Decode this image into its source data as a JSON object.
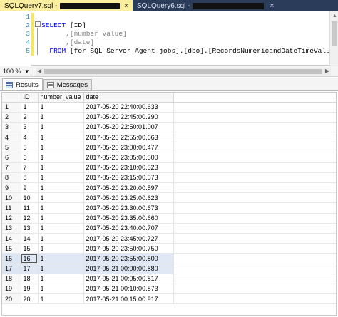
{
  "tabs": [
    {
      "label": "SQLQuery7.sql -",
      "close": "×",
      "active": true
    },
    {
      "label": "SQLQuery6.sql -",
      "close": "×",
      "active": false
    }
  ],
  "editor": {
    "line_numbers": [
      "1",
      "2",
      "3",
      "4",
      "5"
    ],
    "collapse_glyph": "−",
    "lines": [
      {
        "kw": "",
        "rest": ""
      },
      {
        "kw": "SELECT",
        "rest": " [ID]"
      },
      {
        "kw": "",
        "rest": "      ,[number_value]"
      },
      {
        "kw": "",
        "rest": "      ,[date]"
      },
      {
        "kw": "  FROM",
        "rest": " [for_SQL_Server_Agent_jobs].[dbo].[RecordsNumericandDateTimeValues]"
      }
    ]
  },
  "zoom": {
    "value": "100 %",
    "arrow": "▾"
  },
  "result_tabs": [
    {
      "label": "Results",
      "active": true
    },
    {
      "label": "Messages",
      "active": false
    }
  ],
  "grid": {
    "columns": [
      "ID",
      "number_value",
      "date"
    ],
    "rows": [
      {
        "rn": "1",
        "id": "1",
        "nv": "1",
        "date": "2017-05-20 22:40:00.633"
      },
      {
        "rn": "2",
        "id": "2",
        "nv": "1",
        "date": "2017-05-20 22:45:00.290"
      },
      {
        "rn": "3",
        "id": "3",
        "nv": "1",
        "date": "2017-05-20 22:50:01.007"
      },
      {
        "rn": "4",
        "id": "4",
        "nv": "1",
        "date": "2017-05-20 22:55:00.663"
      },
      {
        "rn": "5",
        "id": "5",
        "nv": "1",
        "date": "2017-05-20 23:00:00.477"
      },
      {
        "rn": "6",
        "id": "6",
        "nv": "1",
        "date": "2017-05-20 23:05:00.500"
      },
      {
        "rn": "7",
        "id": "7",
        "nv": "1",
        "date": "2017-05-20 23:10:00.523"
      },
      {
        "rn": "8",
        "id": "8",
        "nv": "1",
        "date": "2017-05-20 23:15:00.573"
      },
      {
        "rn": "9",
        "id": "9",
        "nv": "1",
        "date": "2017-05-20 23:20:00.597"
      },
      {
        "rn": "10",
        "id": "10",
        "nv": "1",
        "date": "2017-05-20 23:25:00.623"
      },
      {
        "rn": "11",
        "id": "11",
        "nv": "1",
        "date": "2017-05-20 23:30:00.673"
      },
      {
        "rn": "12",
        "id": "12",
        "nv": "1",
        "date": "2017-05-20 23:35:00.660"
      },
      {
        "rn": "13",
        "id": "13",
        "nv": "1",
        "date": "2017-05-20 23:40:00.707"
      },
      {
        "rn": "14",
        "id": "14",
        "nv": "1",
        "date": "2017-05-20 23:45:00.727"
      },
      {
        "rn": "15",
        "id": "15",
        "nv": "1",
        "date": "2017-05-20 23:50:00.750"
      },
      {
        "rn": "16",
        "id": "16",
        "nv": "1",
        "date": "2017-05-20 23:55:00.800",
        "selected": true,
        "focus": true
      },
      {
        "rn": "17",
        "id": "17",
        "nv": "1",
        "date": "2017-05-21 00:00:00.880",
        "selected": true
      },
      {
        "rn": "18",
        "id": "18",
        "nv": "1",
        "date": "2017-05-21 00:05:00.817"
      },
      {
        "rn": "19",
        "id": "19",
        "nv": "1",
        "date": "2017-05-21 00:10:00.873"
      },
      {
        "rn": "20",
        "id": "20",
        "nv": "1",
        "date": "2017-05-21 00:15:00.917"
      }
    ]
  },
  "colors": {
    "tab_active": "#fbee9e",
    "tab_strip": "#2b3b5a",
    "keyword": "#0000ff",
    "line_number": "#2b91af",
    "selection": "#dfe8f4"
  }
}
